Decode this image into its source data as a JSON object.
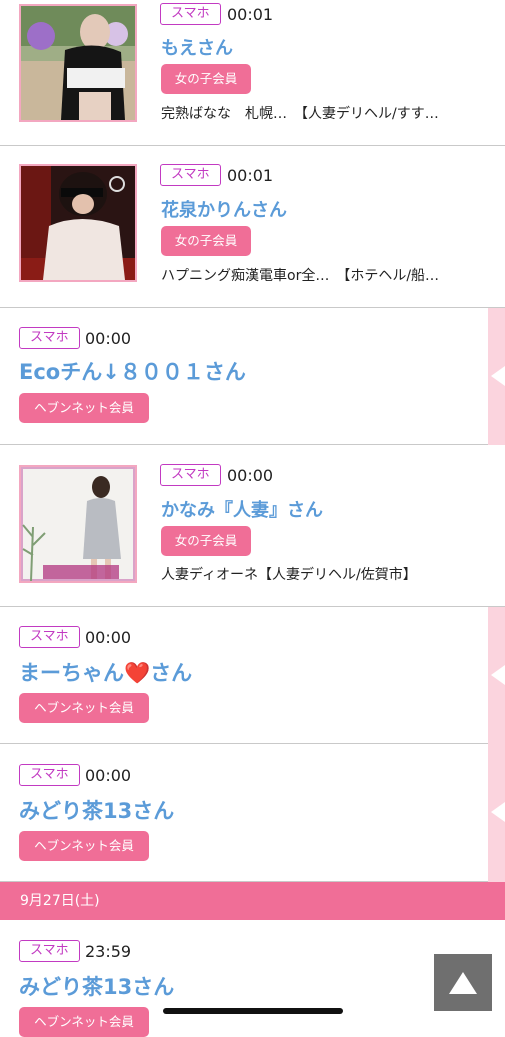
{
  "entries": [
    {
      "device": "スマホ",
      "time": "00:01",
      "name": "もえさん",
      "member": "女の子会員",
      "shop": "完熟ばなな　札幌…　【人妻デリヘル/すす…",
      "photo": "woman outdoors with face blurred"
    },
    {
      "device": "スマホ",
      "time": "00:01",
      "name": "花泉かりんさん",
      "member": "女の子会員",
      "shop": "ハプニング痴漢電車or全…　【ホテヘル/船…",
      "photo": "woman in white blouse with eyes covered"
    },
    {
      "device": "スマホ",
      "time": "00:00",
      "name": "Ecoチん↓８００１さん",
      "member": "ヘブンネット会員"
    },
    {
      "device": "スマホ",
      "time": "00:00",
      "name": "かなみ『人妻』さん",
      "member": "女の子会員",
      "shop": "人妻ディオーネ【人妻デリヘル/佐賀市】",
      "photo": "woman in grey dress in a white room"
    },
    {
      "device": "スマホ",
      "time": "00:00",
      "name": "まーちゃん❤️さん",
      "member": "ヘブンネット会員"
    },
    {
      "device": "スマホ",
      "time": "00:00",
      "name": "みどり茶13さん",
      "member": "ヘブンネット会員"
    },
    {
      "device": "スマホ",
      "time": "23:59",
      "name": "みどり茶13さん",
      "member": "ヘブンネット会員"
    }
  ],
  "date_divider": "9月27日(土)",
  "scroll_top_icon": "triangle-up-icon",
  "colors": {
    "pink": "#f06e97",
    "name_blue": "#5b9bd8",
    "badge_purple": "#c23ac2",
    "ribbon_pink": "#fbd4de"
  }
}
